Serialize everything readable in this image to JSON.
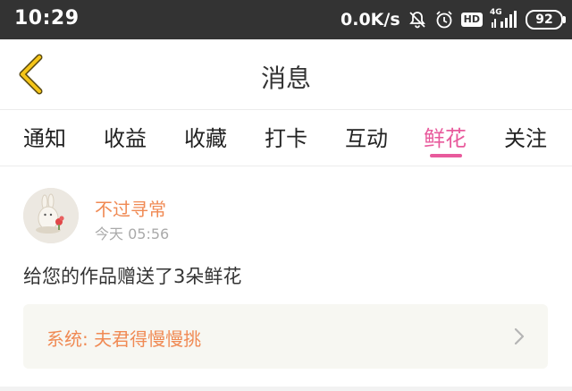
{
  "status_bar": {
    "time": "10:29",
    "network_speed": "0.0K/s",
    "hd_label": "HD",
    "network_type": "4G",
    "battery": "92",
    "icons": [
      "bell-off-icon",
      "alarm-icon",
      "hd-icon",
      "signal-icon",
      "battery-icon"
    ]
  },
  "header": {
    "title": "消息",
    "back_icon": "chevron-left-icon",
    "accent_color": "#f5c518"
  },
  "tabs": [
    {
      "label": "通知"
    },
    {
      "label": "收益"
    },
    {
      "label": "收藏"
    },
    {
      "label": "打卡"
    },
    {
      "label": "互动"
    },
    {
      "label": "鲜花",
      "active": true
    },
    {
      "label": "关注"
    }
  ],
  "active_tab_color": "#e85a9c",
  "message": {
    "username": "不过寻常",
    "time": "今天 05:56",
    "text": "给您的作品赠送了3朵鲜花",
    "system_label": "系统: 夫君得慢慢挑",
    "highlight_color": "#f08a54"
  }
}
